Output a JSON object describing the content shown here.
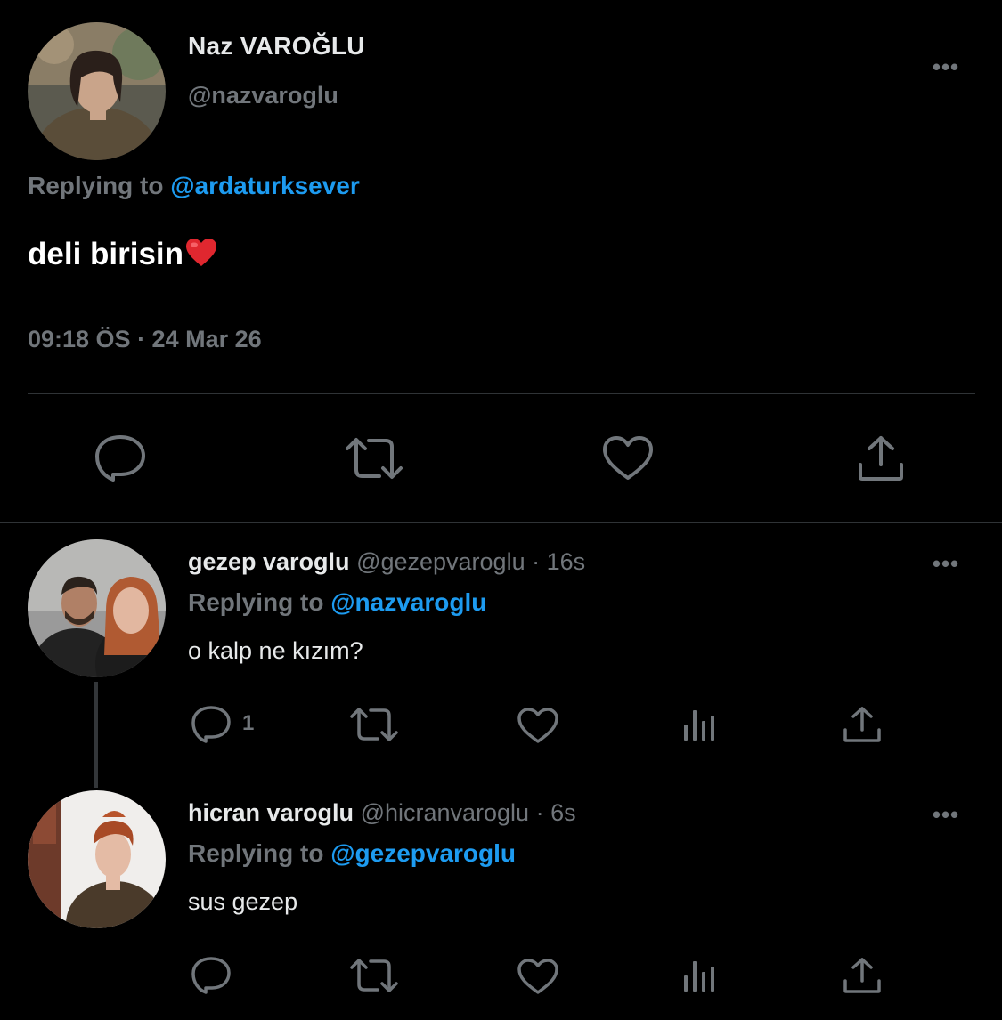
{
  "main_tweet": {
    "name": "Naz VAROĞLU",
    "handle": "@nazvaroglu",
    "replying_prefix": "Replying to",
    "replying_to": "@ardaturksever",
    "text": "deli birisin",
    "emoji": "❤️",
    "timestamp": "09:18 ÖS · 24 Mar 26",
    "more_label": "•••"
  },
  "replies": [
    {
      "name": "gezep varoglu",
      "handle": "@gezepvaroglu",
      "time": "16s",
      "replying_prefix": "Replying to",
      "replying_to": "@nazvaroglu",
      "text": "o kalp ne kızım?",
      "reply_count": "1",
      "more_label": "•••"
    },
    {
      "name": "hicran varoglu",
      "handle": "@hicranvaroglu",
      "time": "6s",
      "replying_prefix": "Replying to",
      "replying_to": "@gezepvaroglu",
      "text": "sus gezep",
      "reply_count": "",
      "more_label": "•••"
    }
  ],
  "separator": " · ",
  "colors": {
    "background": "#000000",
    "text_primary": "#e7e9ea",
    "text_secondary": "#71767b",
    "accent": "#1d9bf0",
    "divider": "#2f3336"
  },
  "icons": [
    "reply-icon",
    "retweet-icon",
    "like-icon",
    "share-icon",
    "analytics-icon",
    "more-icon"
  ]
}
